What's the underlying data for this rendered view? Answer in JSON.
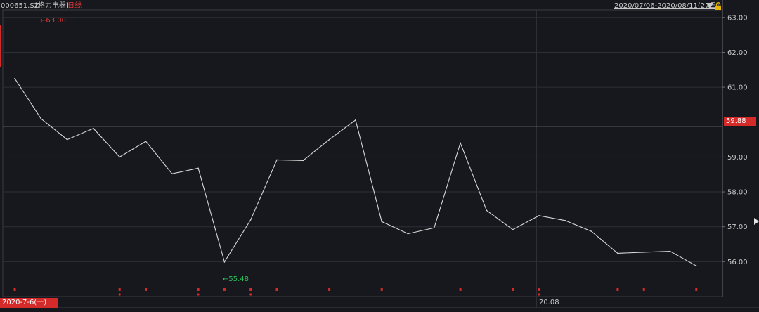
{
  "header": {
    "code": "000651.SZ",
    "name": "[格力电器]",
    "period": "日线",
    "range": "2020/07/06-2020/08/11(27日)",
    "dropdown_icon": "chevron-down-icon",
    "lock_icon": "lock-icon"
  },
  "colors": {
    "background": "#16181d",
    "line": "#d8d8d8",
    "grid": "#2c2f36",
    "red": "#d42a2a",
    "green": "#2fc25b"
  },
  "chart_data": {
    "type": "line",
    "series": [
      {
        "values": [
          61.25,
          60.1,
          59.5,
          59.82,
          59.0,
          59.45,
          58.52,
          58.68,
          55.99,
          57.2,
          58.92,
          58.9,
          59.5,
          60.06,
          57.15,
          56.8,
          56.97,
          59.4,
          57.47,
          56.92,
          57.32,
          57.18,
          56.87,
          56.24,
          56.27,
          56.3,
          55.88
        ]
      }
    ],
    "y_ticks": [
      "63.00",
      "62.00",
      "61.00",
      "59.00",
      "58.00",
      "57.00",
      "56.00"
    ],
    "ylim": [
      54.98,
      63.2
    ],
    "current_price": "59.88",
    "annotations": {
      "high": "←63.00",
      "low": "←55.48"
    },
    "x_labels": {
      "start": "2020-7-6(一)",
      "mark": "20.08"
    },
    "event_markers": [
      0,
      4,
      5,
      7,
      8,
      9,
      10,
      12,
      14,
      17,
      19,
      20,
      23,
      24,
      26
    ],
    "event_dots": [
      4,
      7,
      9,
      20
    ],
    "grid": true
  }
}
